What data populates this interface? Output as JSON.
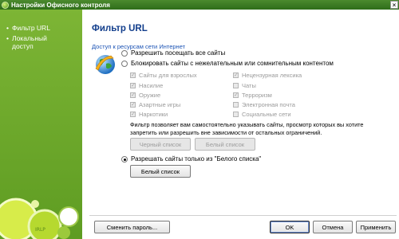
{
  "window": {
    "title": "Настройки Офисного контроля",
    "close_glyph": "×"
  },
  "sidebar": {
    "items": [
      {
        "label": "Фильтр URL",
        "bullet": "•"
      },
      {
        "label": "Локальный доступ",
        "bullet": "•"
      }
    ],
    "logo_text": "IRLP"
  },
  "main": {
    "title": "Фильтр URL",
    "section_label": "Доступ к ресурсам сети Интернет",
    "options": {
      "allow_all": "Разрешить посещать все сайты",
      "block_unwanted": "Блокировать сайты с нежелательным или сомнительным контентом",
      "whitelist_only": "Разрешать сайты только из \"Белого списка\""
    },
    "selected_option": "whitelist_only",
    "categories_left": [
      {
        "label": "Сайты для взрослых",
        "checked": true
      },
      {
        "label": "Насилие",
        "checked": true
      },
      {
        "label": "Оружие",
        "checked": true
      },
      {
        "label": "Азартные игры",
        "checked": true
      },
      {
        "label": "Наркотики",
        "checked": true
      }
    ],
    "categories_right": [
      {
        "label": "Нецензурная лексика",
        "checked": true
      },
      {
        "label": "Чаты",
        "checked": false
      },
      {
        "label": "Терроризм",
        "checked": true
      },
      {
        "label": "Электронная почта",
        "checked": false
      },
      {
        "label": "Социальные сети",
        "checked": false
      }
    ],
    "description": "Фильтр позволяет вам самостоятельно указывать сайты, просмотр которых вы хотите запретить или разрешить вне зависимости от остальных ограничений.",
    "blacklist_button": "Черный список",
    "whitelist_button": "Белый список",
    "whitelist_button2": "Белый список"
  },
  "footer": {
    "change_password": "Сменить пароль...",
    "ok": "OK",
    "cancel": "Отмена",
    "apply": "Применить"
  },
  "colors": {
    "sidebar_green": "#6fa82a",
    "title_blue": "#123e8c",
    "link_blue": "#1a52b4"
  }
}
